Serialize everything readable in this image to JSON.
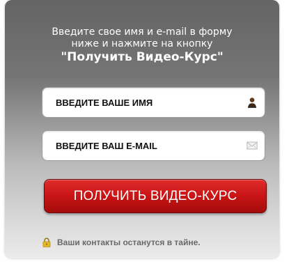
{
  "form": {
    "intro_line1": "Введите свое имя и e-mail в форму",
    "intro_line2": "ниже и нажмите на кнопку",
    "intro_cta_name": "\"Получить Видео-Курс\"",
    "name_field": {
      "placeholder": "ВВЕДИТЕ ВАШЕ ИМЯ",
      "value": "",
      "icon": "user-icon"
    },
    "email_field": {
      "placeholder": "ВВЕДИТЕ ВАШ E-MAIL",
      "value": "",
      "icon": "envelope-icon"
    },
    "submit_label": "ПОЛУЧИТЬ ВИДЕО-КУРС",
    "privacy_note": "Ваши контакты останутся в тайне.",
    "privacy_icon": "lock-icon",
    "colors": {
      "panel_top": "#646464",
      "panel_bottom": "#ececec",
      "button": "#c81414",
      "lock": "#e7b829"
    }
  }
}
